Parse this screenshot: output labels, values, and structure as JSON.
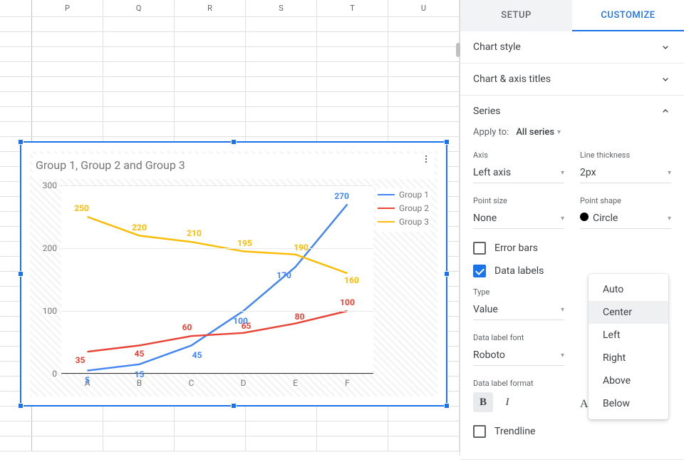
{
  "columns": [
    "P",
    "Q",
    "R",
    "S",
    "T",
    "U"
  ],
  "tabs": {
    "setup": "SETUP",
    "customize": "CUSTOMIZE"
  },
  "sections": {
    "chart_style": "Chart style",
    "chart_axis_titles": "Chart & axis titles",
    "series": "Series"
  },
  "series_panel": {
    "apply_to_label": "Apply to:",
    "apply_to_value": "All series",
    "axis_label": "Axis",
    "axis_value": "Left axis",
    "line_thickness_label": "Line thickness",
    "line_thickness_value": "2px",
    "point_size_label": "Point size",
    "point_size_value": "None",
    "point_shape_label": "Point shape",
    "point_shape_value": "Circle",
    "error_bars": "Error bars",
    "data_labels": "Data labels",
    "type_label": "Type",
    "type_value": "Value",
    "font_label": "Data label font",
    "font_value": "Roboto",
    "format_label": "Data label format",
    "text_color_auto": "Auto",
    "trendline": "Trendline"
  },
  "position_menu": {
    "options": [
      "Auto",
      "Center",
      "Left",
      "Right",
      "Above",
      "Below"
    ],
    "selected": "Center"
  },
  "chart_data": {
    "type": "line",
    "title": "Group 1, Group 2 and Group 3",
    "categories": [
      "A",
      "B",
      "C",
      "D",
      "E",
      "F"
    ],
    "series": [
      {
        "name": "Group 1",
        "color": "#4285f4",
        "values": [
          5,
          15,
          45,
          100,
          170,
          270
        ]
      },
      {
        "name": "Group 2",
        "color": "#ea4335",
        "values": [
          35,
          45,
          60,
          65,
          80,
          100
        ]
      },
      {
        "name": "Group 3",
        "color": "#fbbc04",
        "values": [
          250,
          220,
          210,
          195,
          190,
          160
        ]
      }
    ],
    "ylim": [
      0,
      300
    ],
    "yticks": [
      0,
      100,
      200,
      300
    ],
    "data_labels": true
  }
}
